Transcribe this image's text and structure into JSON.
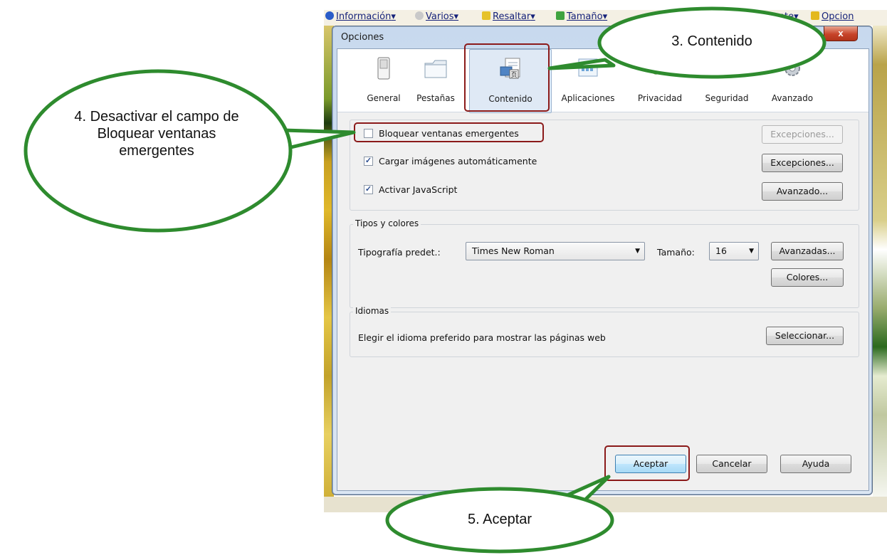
{
  "toolbar": {
    "items": [
      "Información",
      "Varios",
      "Resaltar",
      "Tamaño",
      "fuente",
      "Opcion"
    ]
  },
  "dialog": {
    "title": "Opciones",
    "close_glyph": "x",
    "tabs": [
      {
        "label": "General",
        "icon": "switch-icon"
      },
      {
        "label": "Pestañas",
        "icon": "folder-tab-icon"
      },
      {
        "label": "Contenido",
        "icon": "content-icon",
        "selected": true
      },
      {
        "label": "Aplicaciones",
        "icon": "applications-icon"
      },
      {
        "label": "Privacidad",
        "icon": "mask-icon"
      },
      {
        "label": "Seguridad",
        "icon": "lock-icon"
      },
      {
        "label": "Avanzado",
        "icon": "gear-icon"
      }
    ],
    "content": {
      "popup_block": {
        "label": "Bloquear ventanas emergentes",
        "checked": false,
        "exceptions_label": "Excepciones..."
      },
      "auto_images": {
        "label": "Cargar imágenes automáticamente",
        "checked": true,
        "exceptions_label": "Excepciones..."
      },
      "javascript": {
        "label": "Activar JavaScript",
        "checked": true,
        "advanced_label": "Avanzado..."
      }
    },
    "fonts": {
      "group_label": "Tipos y colores",
      "default_font_label": "Tipografía predet.:",
      "default_font_value": "Times New Roman",
      "size_label": "Tamaño:",
      "size_value": "16",
      "advanced_label": "Avanzadas...",
      "colors_label": "Colores..."
    },
    "languages": {
      "group_label": "Idiomas",
      "description": "Elegir el idioma preferido para mostrar las páginas web",
      "select_label": "Seleccionar..."
    },
    "footer": {
      "accept_label": "Aceptar",
      "cancel_label": "Cancelar",
      "help_label": "Ayuda"
    }
  },
  "callouts": {
    "step3": "3. Contenido",
    "step4": "4. Desactivar el campo de Bloquear ventanas emergentes",
    "step5": "5. Aceptar"
  },
  "colors": {
    "callout_border": "#2e8b2e",
    "highlight": "#8b1a1a"
  }
}
